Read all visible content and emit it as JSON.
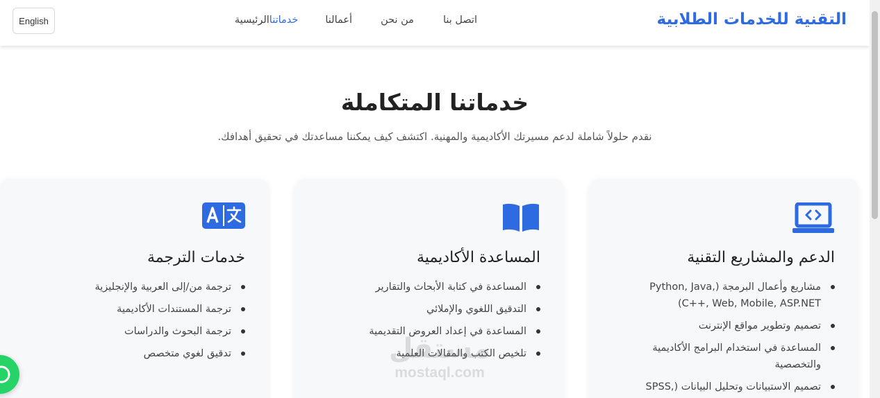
{
  "header": {
    "logo": "التقنية للخدمات الطلابية",
    "nav": [
      {
        "label": "الرئيسية",
        "active": false
      },
      {
        "label": "خدماتنا",
        "active": true
      },
      {
        "label": "أعمالنا",
        "active": false
      },
      {
        "label": "من نحن",
        "active": false
      },
      {
        "label": "اتصل بنا",
        "active": false
      }
    ],
    "language_button": "English"
  },
  "section": {
    "title": "خدماتنا المتكاملة",
    "subtitle": "نقدم حلولاً شاملة لدعم مسيرتك الأكاديمية والمهنية. اكتشف كيف يمكننا مساعدتك في تحقيق أهدافك."
  },
  "cards": [
    {
      "icon": "laptop-code-icon",
      "title": "الدعم والمشاريع التقنية",
      "items": [
        "مشاريع وأعمال البرمجة (Python, Java, C++, Web, Mobile, ASP.NET)",
        "تصميم وتطوير مواقع الإنترنت",
        "المساعدة في استخدام البرامج الأكاديمية والتخصصية",
        "تصميم الاستبيانات وتحليل البيانات (SPSS, Excel,"
      ]
    },
    {
      "icon": "open-book-icon",
      "title": "المساعدة الأكاديمية",
      "items": [
        "المساعدة في كتابة الأبحاث والتقارير",
        "التدقيق اللغوي والإملائي",
        "المساعدة في إعداد العروض التقديمية",
        "تلخيص الكتب والمقالات العلمية"
      ]
    },
    {
      "icon": "translate-icon",
      "title": "خدمات الترجمة",
      "items": [
        "ترجمة من/إلى العربية والإنجليزية",
        "ترجمة المستندات الأكاديمية",
        "ترجمة البحوث والدراسات",
        "تدقيق لغوي متخصص"
      ]
    }
  ],
  "watermark": {
    "arabic": "مستقل",
    "latin": "mostaql.com"
  },
  "colors": {
    "accent": "#2f6be0",
    "whatsapp": "#25d366",
    "card_bg": "#f7f8fa"
  }
}
